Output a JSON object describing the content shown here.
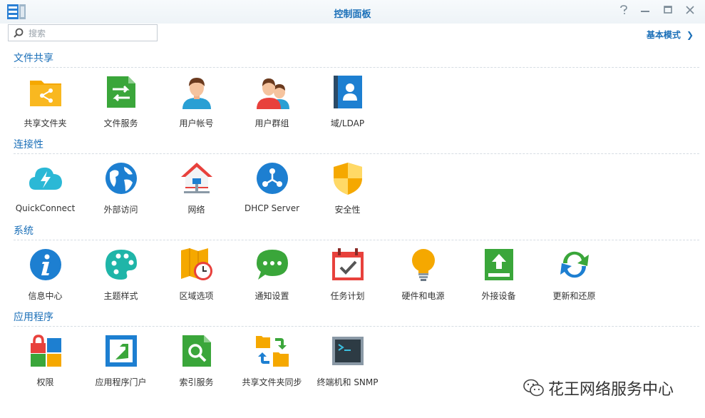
{
  "window": {
    "title": "控制面板"
  },
  "search": {
    "placeholder": "搜索"
  },
  "mode_link": {
    "label": "基本模式"
  },
  "sections": [
    {
      "title": "文件共享",
      "items": [
        "共享文件夹",
        "文件服务",
        "用户帐号",
        "用户群组",
        "域/LDAP"
      ]
    },
    {
      "title": "连接性",
      "items": [
        "QuickConnect",
        "外部访问",
        "网络",
        "DHCP Server",
        "安全性"
      ]
    },
    {
      "title": "系统",
      "items": [
        "信息中心",
        "主题样式",
        "区域选项",
        "通知设置",
        "任务计划",
        "硬件和电源",
        "外接设备",
        "更新和还原"
      ]
    },
    {
      "title": "应用程序",
      "items": [
        "权限",
        "应用程序门户",
        "索引服务",
        "共享文件夹同步",
        "终端机和 SNMP"
      ]
    }
  ],
  "watermark": {
    "text": "花王网络服务中心"
  },
  "colors": {
    "accent": "#1a6fb8",
    "orange": "#f5a800",
    "green": "#28a745",
    "red": "#e8413c"
  }
}
